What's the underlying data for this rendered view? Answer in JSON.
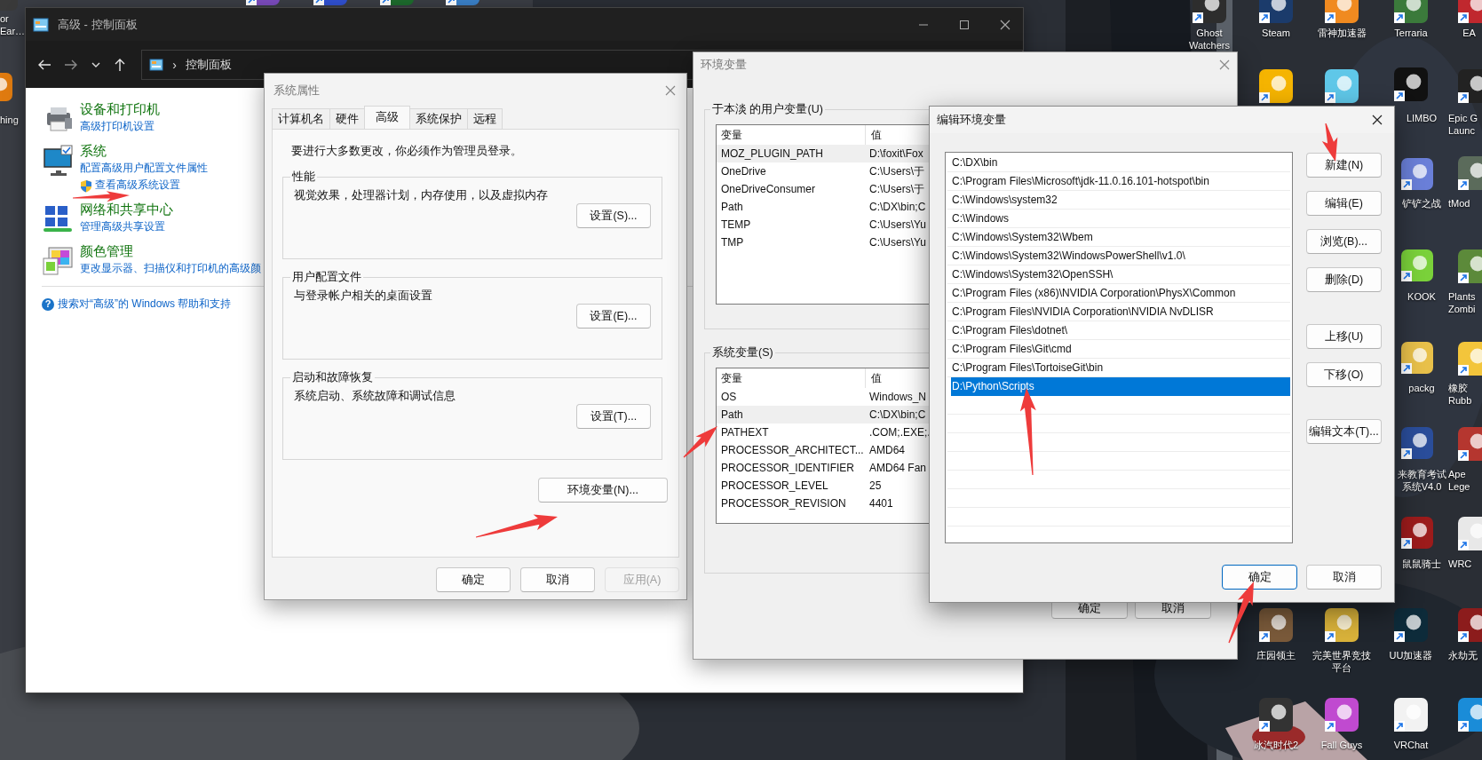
{
  "desktop_icons": [
    {
      "kind": "labelled",
      "lines": [
        "or",
        "Ear…"
      ]
    },
    {
      "kind": "labelled",
      "lines": [
        "hing"
      ]
    },
    {
      "kind": "labelled",
      "lines": [
        "Ghost",
        "Watchers"
      ]
    },
    {
      "kind": "labelled",
      "lines": [
        "Steam"
      ]
    },
    {
      "kind": "labelled",
      "lines": [
        "雷神加速器"
      ]
    },
    {
      "kind": "labelled",
      "lines": [
        "Terraria"
      ]
    },
    {
      "kind": "labelled",
      "lines": [
        "EA"
      ]
    },
    {
      "kind": "unlabelled"
    },
    {
      "kind": "unlabelled"
    },
    {
      "kind": "labelled",
      "lines": [
        "LIMBO"
      ]
    },
    {
      "kind": "labelled",
      "lines": [
        "Epic G",
        "Launc"
      ]
    },
    {
      "kind": "labelled",
      "lines": [
        "铲铲之战"
      ]
    },
    {
      "kind": "labelled",
      "lines": [
        "tMod"
      ]
    },
    {
      "kind": "labelled",
      "lines": [
        "KOOK"
      ]
    },
    {
      "kind": "labelled",
      "lines": [
        "Plants",
        "Zombi"
      ]
    },
    {
      "kind": "labelled",
      "lines": [
        "packg"
      ]
    },
    {
      "kind": "labelled",
      "lines": [
        "橡胶",
        "Rubb"
      ]
    },
    {
      "kind": "labelled",
      "lines": [
        "来教育考试",
        "系统V4.0"
      ]
    },
    {
      "kind": "labelled",
      "lines": [
        "Ape",
        "Lege"
      ]
    },
    {
      "kind": "labelled",
      "lines": [
        "鼠鼠骑士"
      ]
    },
    {
      "kind": "labelled",
      "lines": [
        "WRC"
      ]
    },
    {
      "kind": "labelled",
      "lines": [
        "庄园领主"
      ]
    },
    {
      "kind": "labelled",
      "lines": [
        "完美世界竞技",
        "平台"
      ]
    },
    {
      "kind": "labelled",
      "lines": [
        "UU加速器"
      ]
    },
    {
      "kind": "labelled",
      "lines": [
        "永劫无"
      ]
    },
    {
      "kind": "labelled",
      "lines": [
        "冰汽时代2"
      ]
    },
    {
      "kind": "labelled",
      "lines": [
        "Fall Guys"
      ]
    },
    {
      "kind": "labelled",
      "lines": [
        "VRChat"
      ]
    },
    {
      "kind": "unlabelled"
    },
    {
      "kind": "unlabelled"
    },
    {
      "kind": "unlabelled"
    },
    {
      "kind": "unlabelled"
    },
    {
      "kind": "unlabelled"
    }
  ],
  "control_panel": {
    "title": "高级 - 控制面板",
    "breadcrumb_separator": "›",
    "breadcrumb": "控制面板",
    "categories": [
      {
        "title": "设备和打印机",
        "links": [
          {
            "text": "高级打印机设置",
            "kind": "plain"
          }
        ]
      },
      {
        "title": "系统",
        "links": [
          {
            "text": "配置高级用户配置文件属性",
            "kind": "plain"
          },
          {
            "text": "查看高级系统设置",
            "kind": "admin"
          }
        ]
      },
      {
        "title": "网络和共享中心",
        "links": [
          {
            "text": "管理高级共享设置",
            "kind": "plain"
          }
        ]
      },
      {
        "title": "颜色管理",
        "links": [
          {
            "text": "更改显示器、扫描仪和打印机的高级颜",
            "kind": "plain"
          }
        ]
      }
    ],
    "help_icon": "?",
    "help_link": "搜索对“高级”的 Windows 帮助和支持"
  },
  "system_properties": {
    "title": "系统属性",
    "tabs": [
      {
        "label": "计算机名",
        "selected": false
      },
      {
        "label": "硬件",
        "selected": false
      },
      {
        "label": "高级",
        "selected": true
      },
      {
        "label": "系统保护",
        "selected": false
      },
      {
        "label": "远程",
        "selected": false
      }
    ],
    "admin_note": "要进行大多数更改，你必须作为管理员登录。",
    "groups": [
      {
        "title": "性能",
        "description": "视觉效果，处理器计划，内存使用，以及虚拟内存",
        "button": "设置(S)..."
      },
      {
        "title": "用户配置文件",
        "description": "与登录帐户相关的桌面设置",
        "button": "设置(E)..."
      },
      {
        "title": "启动和故障恢复",
        "description": "系统启动、系统故障和调试信息",
        "button": "设置(T)..."
      }
    ],
    "env_button": "环境变量(N)...",
    "buttons": [
      {
        "label": "确定",
        "disabled": false
      },
      {
        "label": "取消",
        "disabled": false
      },
      {
        "label": "应用(A)",
        "disabled": true
      }
    ]
  },
  "environment_variables": {
    "title": "环境变量",
    "user_group": {
      "title": "于本淡 的用户变量(U)",
      "columns": [
        "变量",
        "值"
      ],
      "rows": [
        {
          "name": "MOZ_PLUGIN_PATH",
          "value": "D:\\foxit\\Fox",
          "selected": true
        },
        {
          "name": "OneDrive",
          "value": "C:\\Users\\于",
          "selected": false
        },
        {
          "name": "OneDriveConsumer",
          "value": "C:\\Users\\于",
          "selected": false
        },
        {
          "name": "Path",
          "value": "C:\\DX\\bin;C",
          "selected": false
        },
        {
          "name": "TEMP",
          "value": "C:\\Users\\Yu",
          "selected": false
        },
        {
          "name": "TMP",
          "value": "C:\\Users\\Yu",
          "selected": false
        }
      ]
    },
    "system_group": {
      "title": "系统变量(S)",
      "columns": [
        "变量",
        "值"
      ],
      "rows": [
        {
          "name": "OS",
          "value": "Windows_N",
          "selected": false
        },
        {
          "name": "Path",
          "value": "C:\\DX\\bin;C",
          "selected": true
        },
        {
          "name": "PATHEXT",
          "value": ".COM;.EXE;.",
          "selected": false
        },
        {
          "name": "PROCESSOR_ARCHITECT...",
          "value": "AMD64",
          "selected": false
        },
        {
          "name": "PROCESSOR_IDENTIFIER",
          "value": "AMD64 Fan",
          "selected": false
        },
        {
          "name": "PROCESSOR_LEVEL",
          "value": "25",
          "selected": false
        },
        {
          "name": "PROCESSOR_REVISION",
          "value": "4401",
          "selected": false
        }
      ]
    },
    "buttons": [
      "确定",
      "取消"
    ]
  },
  "edit_variable": {
    "title": "编辑环境变量",
    "entries": [
      {
        "text": "C:\\DX\\bin",
        "selected": false
      },
      {
        "text": "C:\\Program Files\\Microsoft\\jdk-11.0.16.101-hotspot\\bin",
        "selected": false
      },
      {
        "text": "C:\\Windows\\system32",
        "selected": false
      },
      {
        "text": "C:\\Windows",
        "selected": false
      },
      {
        "text": "C:\\Windows\\System32\\Wbem",
        "selected": false
      },
      {
        "text": "C:\\Windows\\System32\\WindowsPowerShell\\v1.0\\",
        "selected": false
      },
      {
        "text": "C:\\Windows\\System32\\OpenSSH\\",
        "selected": false
      },
      {
        "text": "C:\\Program Files (x86)\\NVIDIA Corporation\\PhysX\\Common",
        "selected": false
      },
      {
        "text": "C:\\Program Files\\NVIDIA Corporation\\NVIDIA NvDLISR",
        "selected": false
      },
      {
        "text": "C:\\Program Files\\dotnet\\",
        "selected": false
      },
      {
        "text": "C:\\Program Files\\Git\\cmd",
        "selected": false
      },
      {
        "text": "C:\\Program Files\\TortoiseGit\\bin",
        "selected": false
      },
      {
        "text": "D:\\Python\\Scripts",
        "selected": true
      }
    ],
    "side_buttons": [
      "新建(N)",
      "编辑(E)",
      "浏览(B)...",
      "删除(D)",
      "上移(U)",
      "下移(O)",
      "编辑文本(T)..."
    ],
    "buttons": [
      {
        "label": "确定",
        "default": true
      },
      {
        "label": "取消",
        "default": false
      }
    ]
  }
}
